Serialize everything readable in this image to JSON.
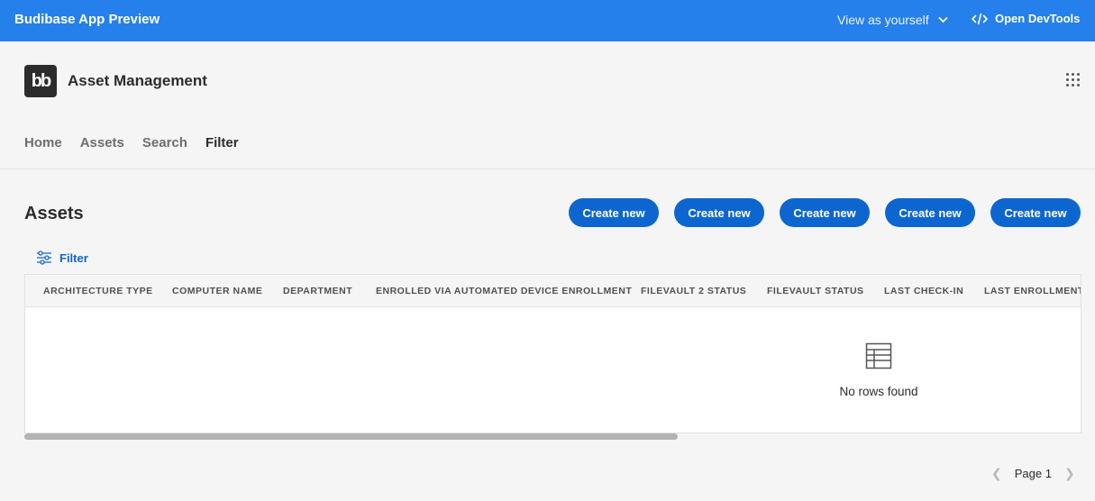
{
  "topbar": {
    "title": "Budibase App Preview",
    "view_as": "View as yourself",
    "devtools": "Open DevTools"
  },
  "app": {
    "logo_text": "bb",
    "title": "Asset Management"
  },
  "nav": {
    "items": [
      {
        "label": "Home"
      },
      {
        "label": "Assets"
      },
      {
        "label": "Search"
      },
      {
        "label": "Filter"
      }
    ]
  },
  "page": {
    "title": "Assets",
    "buttons": [
      {
        "label": "Create new"
      },
      {
        "label": "Create new"
      },
      {
        "label": "Create new"
      },
      {
        "label": "Create new"
      },
      {
        "label": "Create new"
      }
    ],
    "filter_label": "Filter"
  },
  "table": {
    "columns": [
      "ARCHITECTURE TYPE",
      "COMPUTER NAME",
      "DEPARTMENT",
      "ENROLLED VIA AUTOMATED DEVICE ENROLLMENT",
      "FILEVAULT 2 STATUS",
      "FILEVAULT STATUS",
      "LAST CHECK-IN",
      "LAST ENROLLMENT"
    ],
    "empty_text": "No rows found"
  },
  "pagination": {
    "label": "Page 1"
  }
}
